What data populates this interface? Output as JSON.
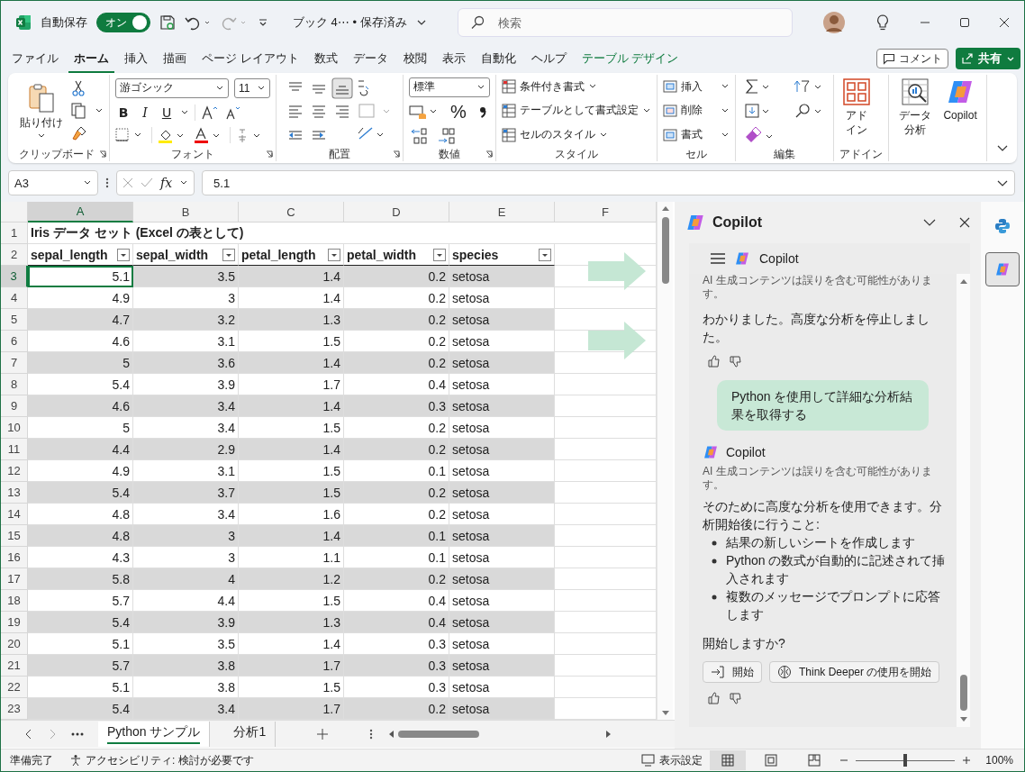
{
  "title_bar": {
    "autosave_label": "自動保存",
    "autosave": {
      "label": "オン",
      "on": true
    },
    "document_title": "ブック 4⋯ • 保存済み",
    "search": {
      "placeholder": "検索"
    }
  },
  "menu_tabs": [
    {
      "label": "ファイル",
      "selected": false,
      "kind": "standard"
    },
    {
      "label": "ホーム",
      "selected": true,
      "kind": "standard"
    },
    {
      "label": "挿入",
      "selected": false,
      "kind": "standard"
    },
    {
      "label": "描画",
      "selected": false,
      "kind": "standard"
    },
    {
      "label": "ページ レイアウト",
      "selected": false,
      "kind": "standard"
    },
    {
      "label": "数式",
      "selected": false,
      "kind": "standard"
    },
    {
      "label": "データ",
      "selected": false,
      "kind": "standard"
    },
    {
      "label": "校閲",
      "selected": false,
      "kind": "standard"
    },
    {
      "label": "表示",
      "selected": false,
      "kind": "standard"
    },
    {
      "label": "自動化",
      "selected": false,
      "kind": "standard"
    },
    {
      "label": "ヘルプ",
      "selected": false,
      "kind": "standard"
    },
    {
      "label": "テーブル デザイン",
      "selected": false,
      "kind": "contextual"
    }
  ],
  "comment_button": "コメント",
  "share_button": "共有",
  "ribbon": {
    "groups": [
      {
        "kind": "clipboard",
        "label": "クリップボード",
        "paste": "貼り付け"
      },
      {
        "kind": "font",
        "label": "フォント",
        "font_name": "游ゴシック",
        "font_size": "11",
        "styles": [
          "B",
          "I",
          "U"
        ]
      },
      {
        "kind": "alignment",
        "label": "配置"
      },
      {
        "kind": "number",
        "label": "数値",
        "format": "標準",
        "percent": "%"
      },
      {
        "kind": "styles",
        "label": "スタイル",
        "items": [
          "条件付き書式",
          "テーブルとして書式設定",
          "セルのスタイル"
        ]
      },
      {
        "kind": "cells",
        "label": "セル",
        "items": [
          "挿入",
          "削除",
          "書式"
        ]
      },
      {
        "kind": "editing",
        "label": "編集"
      },
      {
        "kind": "addins",
        "label": "アドイン",
        "button": "アドイン"
      },
      {
        "kind": "analysis",
        "buttons": [
          "データ分析",
          "Copilot"
        ]
      }
    ]
  },
  "formula_bar": {
    "name_box": "A3",
    "function_label": "fx",
    "value": "5.1"
  },
  "sheet": {
    "columns": [
      {
        "label": "A",
        "selected": true
      },
      {
        "label": "B",
        "selected": false
      },
      {
        "label": "C",
        "selected": false
      },
      {
        "label": "D",
        "selected": false
      },
      {
        "label": "E",
        "selected": false
      },
      {
        "label": "F",
        "selected": false
      }
    ],
    "title_row": {
      "number": "1",
      "text": "Iris データ セット (Excel の表として)"
    },
    "header_row": {
      "number": "2",
      "headers": [
        "sepal_length",
        "sepal_width",
        "petal_length",
        "petal_width",
        "species"
      ]
    },
    "rows": [
      {
        "number": "3",
        "selected": true,
        "shaded": true,
        "cells": [
          "5.1",
          "3.5",
          "1.4",
          "0.2",
          "setosa"
        ]
      },
      {
        "number": "4",
        "selected": false,
        "shaded": false,
        "cells": [
          "4.9",
          "3",
          "1.4",
          "0.2",
          "setosa"
        ]
      },
      {
        "number": "5",
        "selected": false,
        "shaded": true,
        "cells": [
          "4.7",
          "3.2",
          "1.3",
          "0.2",
          "setosa"
        ]
      },
      {
        "number": "6",
        "selected": false,
        "shaded": false,
        "cells": [
          "4.6",
          "3.1",
          "1.5",
          "0.2",
          "setosa"
        ]
      },
      {
        "number": "7",
        "selected": false,
        "shaded": true,
        "cells": [
          "5",
          "3.6",
          "1.4",
          "0.2",
          "setosa"
        ]
      },
      {
        "number": "8",
        "selected": false,
        "shaded": false,
        "cells": [
          "5.4",
          "3.9",
          "1.7",
          "0.4",
          "setosa"
        ]
      },
      {
        "number": "9",
        "selected": false,
        "shaded": true,
        "cells": [
          "4.6",
          "3.4",
          "1.4",
          "0.3",
          "setosa"
        ]
      },
      {
        "number": "10",
        "selected": false,
        "shaded": false,
        "cells": [
          "5",
          "3.4",
          "1.5",
          "0.2",
          "setosa"
        ]
      },
      {
        "number": "11",
        "selected": false,
        "shaded": true,
        "cells": [
          "4.4",
          "2.9",
          "1.4",
          "0.2",
          "setosa"
        ]
      },
      {
        "number": "12",
        "selected": false,
        "shaded": false,
        "cells": [
          "4.9",
          "3.1",
          "1.5",
          "0.1",
          "setosa"
        ]
      },
      {
        "number": "13",
        "selected": false,
        "shaded": true,
        "cells": [
          "5.4",
          "3.7",
          "1.5",
          "0.2",
          "setosa"
        ]
      },
      {
        "number": "14",
        "selected": false,
        "shaded": false,
        "cells": [
          "4.8",
          "3.4",
          "1.6",
          "0.2",
          "setosa"
        ]
      },
      {
        "number": "15",
        "selected": false,
        "shaded": true,
        "cells": [
          "4.8",
          "3",
          "1.4",
          "0.1",
          "setosa"
        ]
      },
      {
        "number": "16",
        "selected": false,
        "shaded": false,
        "cells": [
          "4.3",
          "3",
          "1.1",
          "0.1",
          "setosa"
        ]
      },
      {
        "number": "17",
        "selected": false,
        "shaded": true,
        "cells": [
          "5.8",
          "4",
          "1.2",
          "0.2",
          "setosa"
        ]
      },
      {
        "number": "18",
        "selected": false,
        "shaded": false,
        "cells": [
          "5.7",
          "4.4",
          "1.5",
          "0.4",
          "setosa"
        ]
      },
      {
        "number": "19",
        "selected": false,
        "shaded": true,
        "cells": [
          "5.4",
          "3.9",
          "1.3",
          "0.4",
          "setosa"
        ]
      },
      {
        "number": "20",
        "selected": false,
        "shaded": false,
        "cells": [
          "5.1",
          "3.5",
          "1.4",
          "0.3",
          "setosa"
        ]
      },
      {
        "number": "21",
        "selected": false,
        "shaded": true,
        "cells": [
          "5.7",
          "3.8",
          "1.7",
          "0.3",
          "setosa"
        ]
      },
      {
        "number": "22",
        "selected": false,
        "shaded": false,
        "cells": [
          "5.1",
          "3.8",
          "1.5",
          "0.3",
          "setosa"
        ]
      },
      {
        "number": "23",
        "selected": false,
        "shaded": true,
        "cells": [
          "5.4",
          "3.4",
          "1.7",
          "0.2",
          "setosa"
        ]
      }
    ]
  },
  "copilot": {
    "title": "Copilot",
    "chat_header": "Copilot",
    "top_disclaimer": "AI 生成コンテンツは誤りを含む可能性があります。",
    "messages": [
      {
        "kind": "assistant",
        "text": "わかりました。高度な分析を停止しました。"
      },
      {
        "kind": "user",
        "text": "Python を使用して詳細な分析結果を取得する"
      },
      {
        "kind": "assistant_full",
        "sender": "Copilot",
        "disclaimer": "AI 生成コンテンツは誤りを含む可能性があります。",
        "intro": "そのために高度な分析を使用できます。分析開始後に行うこと:",
        "bullets": [
          "結果の新しいシートを作成します",
          "Python の数式が自動的に記述されて挿入されます",
          "複数のメッセージでプロンプトに応答します"
        ],
        "question": "開始しますか?",
        "actions": [
          {
            "kind": "start",
            "label": "開始"
          },
          {
            "kind": "think",
            "label": "Think Deeper の使用を開始"
          }
        ]
      }
    ]
  },
  "side_rail": [
    {
      "kind": "python",
      "selected": false
    },
    {
      "kind": "copilot",
      "selected": true
    }
  ],
  "sheet_tabs": [
    {
      "label": "Python サンプル",
      "selected": true
    },
    {
      "label": "分析1",
      "selected": false
    }
  ],
  "status_bar": {
    "ready": "準備完了",
    "accessibility": "アクセシビリティ: 検討が必要です",
    "display_settings": "表示設定",
    "views": [
      {
        "kind": "normal",
        "selected": true
      },
      {
        "kind": "page_layout",
        "selected": false
      },
      {
        "kind": "page_break",
        "selected": false
      }
    ],
    "zoom": {
      "level": 0.5,
      "label": "100%"
    }
  }
}
